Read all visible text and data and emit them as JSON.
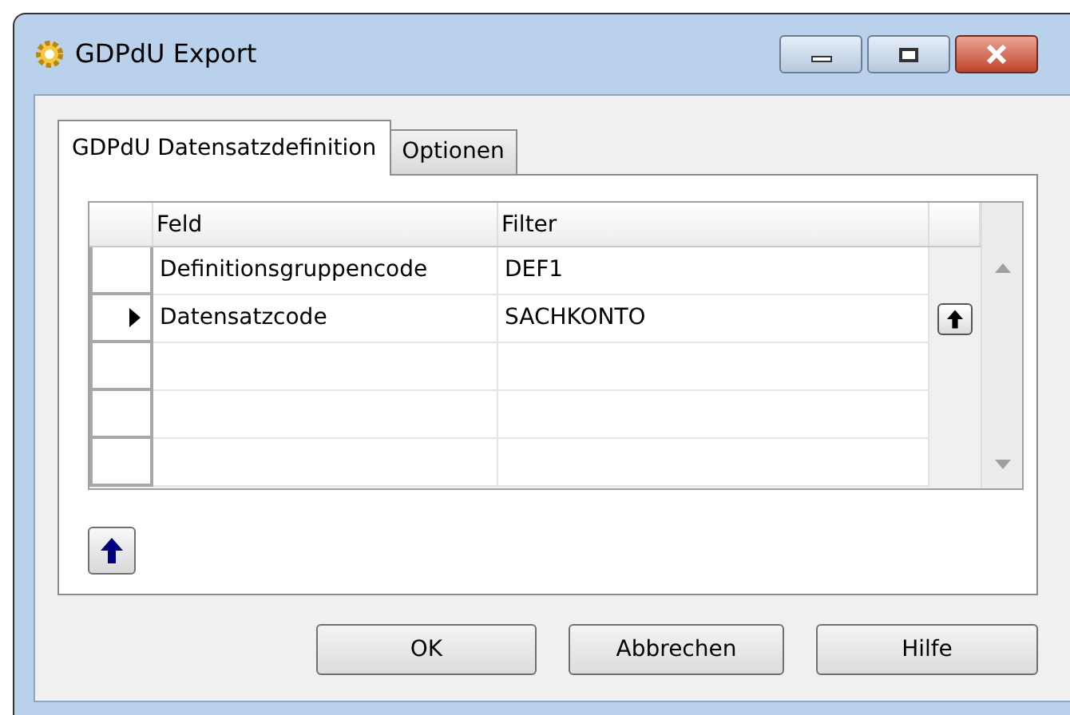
{
  "window": {
    "title": "GDPdU Export"
  },
  "tabs": [
    {
      "label": "GDPdU Datensatzdefinition",
      "selected": true
    },
    {
      "label": "Optionen",
      "selected": false
    }
  ],
  "grid": {
    "columns": [
      "Feld",
      "Filter"
    ],
    "rows": [
      {
        "cells": [
          "Definitionsgruppencode",
          "DEF1"
        ],
        "current": false,
        "row_button": false
      },
      {
        "cells": [
          "Datensatzcode",
          "SACHKONTO"
        ],
        "current": true,
        "row_button": true
      },
      {
        "cells": [
          "",
          ""
        ],
        "current": false,
        "row_button": false
      },
      {
        "cells": [
          "",
          ""
        ],
        "current": false,
        "row_button": false
      },
      {
        "cells": [
          "",
          ""
        ],
        "current": false,
        "row_button": false
      }
    ]
  },
  "buttons": [
    "OK",
    "Abbrechen",
    "Hilfe"
  ]
}
